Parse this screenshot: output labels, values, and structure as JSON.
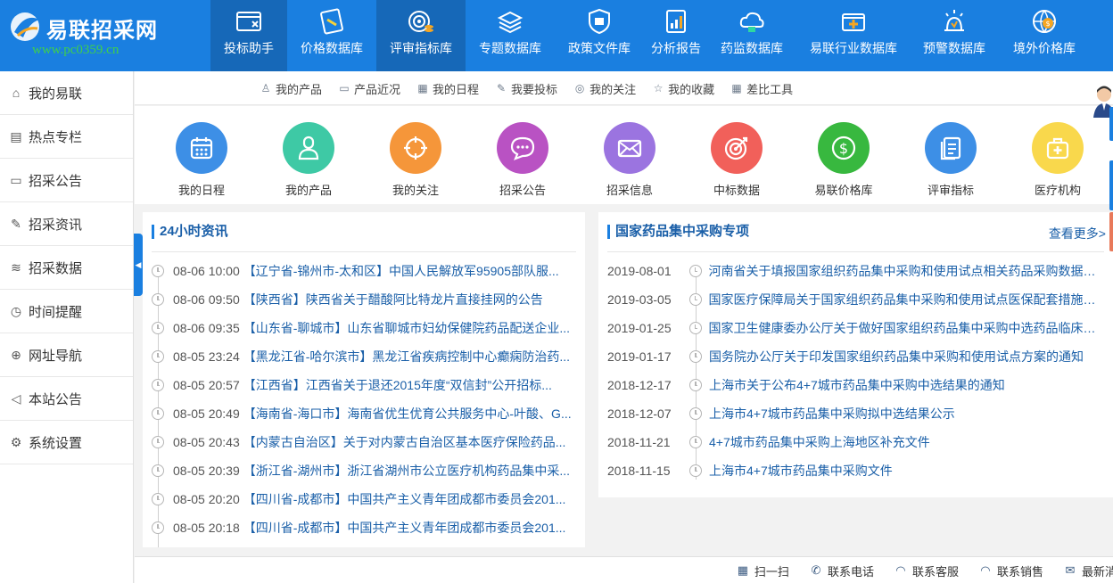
{
  "app": {
    "title": "易联招采网",
    "watermark": "www.pc0359.cn"
  },
  "nav": [
    {
      "label": "投标助手",
      "icon": "bid-assistant-icon",
      "active": true
    },
    {
      "label": "价格数据库",
      "icon": "price-db-icon",
      "active": false
    },
    {
      "label": "评审指标库",
      "icon": "review-index-icon",
      "active": true
    },
    {
      "label": "专题数据库",
      "icon": "topic-db-icon",
      "active": false
    },
    {
      "label": "政策文件库",
      "icon": "policy-icon",
      "active": false
    },
    {
      "label": "分析报告",
      "icon": "report-icon",
      "active": false
    },
    {
      "label": "药监数据库",
      "icon": "drug-cloud-icon",
      "active": false
    },
    {
      "label": "易联行业数据库",
      "icon": "industry-db-icon",
      "active": false
    },
    {
      "label": "预警数据库",
      "icon": "warning-icon",
      "active": false
    },
    {
      "label": "境外价格库",
      "icon": "foreign-price-icon",
      "active": false
    }
  ],
  "sidebar": {
    "items": [
      {
        "label": "我的易联",
        "icon": "home-icon"
      },
      {
        "label": "热点专栏",
        "icon": "document-icon"
      },
      {
        "label": "招采公告",
        "icon": "book-icon"
      },
      {
        "label": "招采资讯",
        "icon": "edit-icon"
      },
      {
        "label": "招采数据",
        "icon": "layers-icon"
      },
      {
        "label": "时间提醒",
        "icon": "alarm-icon"
      },
      {
        "label": "网址导航",
        "icon": "globe-icon"
      },
      {
        "label": "本站公告",
        "icon": "speaker-icon"
      },
      {
        "label": "系统设置",
        "icon": "gear-icon"
      }
    ]
  },
  "subnav": [
    {
      "label": "我的产品",
      "icon": "user-icon"
    },
    {
      "label": "产品近况",
      "icon": "monitor-icon"
    },
    {
      "label": "我的日程",
      "icon": "calendar-icon"
    },
    {
      "label": "我要投标",
      "icon": "edit-icon"
    },
    {
      "label": "我的关注",
      "icon": "target-icon"
    },
    {
      "label": "我的收藏",
      "icon": "star-icon"
    },
    {
      "label": "差比工具",
      "icon": "calculator-icon"
    }
  ],
  "quick": [
    {
      "label": "我的日程",
      "color": "#3d8fe6",
      "icon": "calendar-icon"
    },
    {
      "label": "我的产品",
      "color": "#3ec9a5",
      "icon": "person-icon"
    },
    {
      "label": "我的关注",
      "color": "#f5963a",
      "icon": "crosshair-icon"
    },
    {
      "label": "招采公告",
      "color": "#b952c3",
      "icon": "chat-icon"
    },
    {
      "label": "招采信息",
      "color": "#9b74e0",
      "icon": "mail-icon"
    },
    {
      "label": "中标数据",
      "color": "#f1605a",
      "icon": "dartboard-icon"
    },
    {
      "label": "易联价格库",
      "color": "#38b83f",
      "icon": "dollar-icon"
    },
    {
      "label": "评审指标",
      "color": "#3d8fe6",
      "icon": "files-icon"
    },
    {
      "label": "医疗机构",
      "color": "#f9d84c",
      "icon": "medkit-icon"
    }
  ],
  "news": {
    "title": "24小时资讯",
    "items": [
      {
        "date": "08-06 10:00",
        "title": "【辽宁省-锦州市-太和区】中国人民解放军95905部队服..."
      },
      {
        "date": "08-06 09:50",
        "title": "【陕西省】陕西省关于醋酸阿比特龙片直接挂网的公告"
      },
      {
        "date": "08-06 09:35",
        "title": "【山东省-聊城市】山东省聊城市妇幼保健院药品配送企业..."
      },
      {
        "date": "08-05 23:24",
        "title": "【黑龙江省-哈尔滨市】黑龙江省疾病控制中心癫痫防治药..."
      },
      {
        "date": "08-05 20:57",
        "title": "【江西省】江西省关于退还2015年度“双信封”公开招标..."
      },
      {
        "date": "08-05 20:49",
        "title": "【海南省-海口市】海南省优生优育公共服务中心-叶酸、G..."
      },
      {
        "date": "08-05 20:43",
        "title": "【内蒙古自治区】关于对内蒙古自治区基本医疗保险药品..."
      },
      {
        "date": "08-05 20:39",
        "title": "【浙江省-湖州市】浙江省湖州市公立医疗机构药品集中采..."
      },
      {
        "date": "08-05 20:20",
        "title": "【四川省-成都市】中国共产主义青年团成都市委员会201..."
      },
      {
        "date": "08-05 20:18",
        "title": "【四川省-成都市】中国共产主义青年团成都市委员会201..."
      }
    ]
  },
  "procurement": {
    "title": "国家药品集中采购专项",
    "more": "查看更多>",
    "items": [
      {
        "date": "2019-08-01",
        "title": "河南省关于填报国家组织药品集中采购和使用试点相关药品采购数据的..."
      },
      {
        "date": "2019-03-05",
        "title": "国家医疗保障局关于国家组织药品集中采购和使用试点医保配套措施的..."
      },
      {
        "date": "2019-01-25",
        "title": "国家卫生健康委办公厅关于做好国家组织药品集中采购中选药品临床配..."
      },
      {
        "date": "2019-01-17",
        "title": "国务院办公厅关于印发国家组织药品集中采购和使用试点方案的通知"
      },
      {
        "date": "2018-12-17",
        "title": "上海市关于公布4+7城市药品集中采购中选结果的通知"
      },
      {
        "date": "2018-12-07",
        "title": "上海市4+7城市药品集中采购拟中选结果公示"
      },
      {
        "date": "2018-11-21",
        "title": "4+7城市药品集中采购上海地区补充文件"
      },
      {
        "date": "2018-11-15",
        "title": "上海市4+7城市药品集中采购文件"
      }
    ]
  },
  "footer": [
    {
      "label": "扫一扫",
      "icon": "qrcode-icon"
    },
    {
      "label": "联系电话",
      "icon": "phone-icon"
    },
    {
      "label": "联系客服",
      "icon": "headset-icon"
    },
    {
      "label": "联系销售",
      "icon": "sales-icon"
    },
    {
      "label": "最新消",
      "icon": "message-icon"
    }
  ],
  "colors": {
    "brand": "#1a7fe0",
    "nav_active": "#1668b8",
    "link": "#1a5fa8",
    "edge_tabs": [
      "#1a7fe0",
      "#1a7fe0",
      "#e8795a"
    ]
  }
}
